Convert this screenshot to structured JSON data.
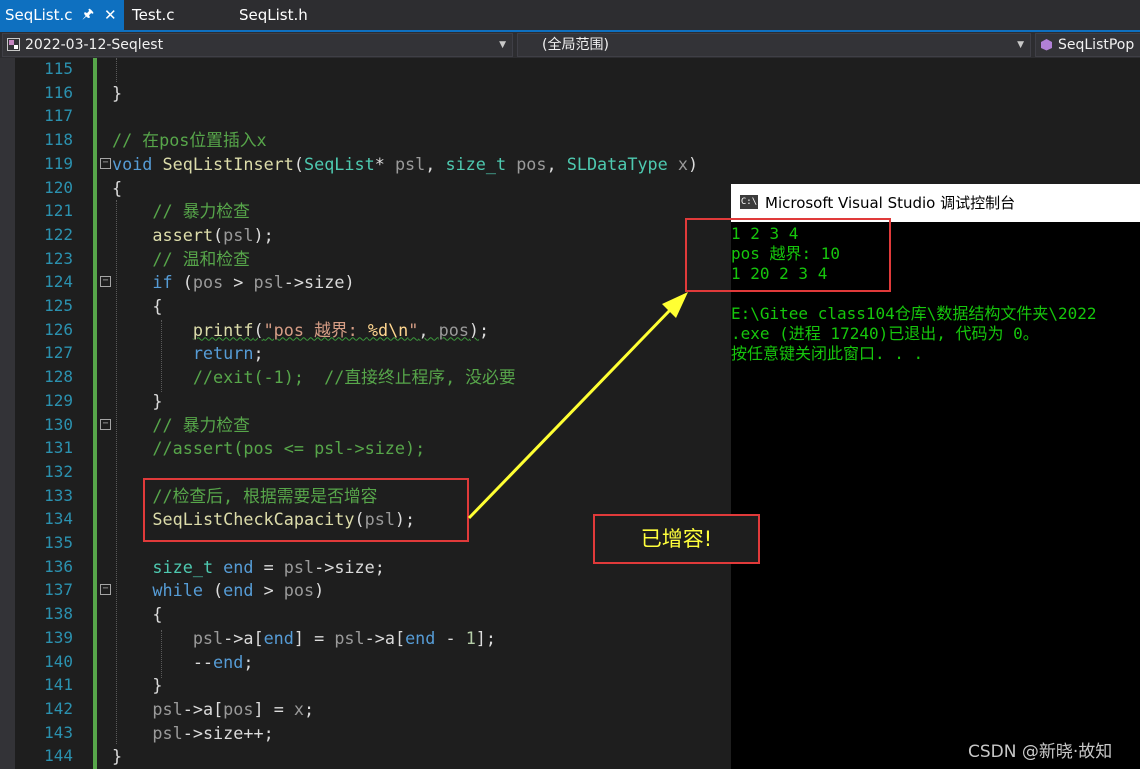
{
  "tabs": [
    {
      "label": "SeqList.c",
      "active": true
    },
    {
      "label": "Test.c",
      "active": false
    },
    {
      "label": "SeqList.h",
      "active": false
    }
  ],
  "tab_pin_icon": "pin-icon",
  "tab_close_icon": "close-icon",
  "navbar": {
    "project": "2022-03-12-Seqlest",
    "scope": "(全局范围)",
    "member": "SeqListPop"
  },
  "editor": {
    "lines": [
      {
        "n": "115",
        "html": "<span class=\"pa\"></span>"
      },
      {
        "n": "116",
        "html": "}"
      },
      {
        "n": "117",
        "html": ""
      },
      {
        "n": "118",
        "html": "<span class=\"cm\">// 在pos位置插入x</span>"
      },
      {
        "n": "119",
        "html": "<span class=\"kw\">void</span> <span class=\"fn\">SeqListInsert</span>(<span class=\"ty\">SeqList</span>* <span class=\"pa\">psl</span>, <span class=\"ty\">size_t</span> <span class=\"pa\">pos</span>, <span class=\"ty\">SLDataType</span> <span class=\"pa\">x</span>)"
      },
      {
        "n": "120",
        "html": "{"
      },
      {
        "n": "121",
        "html": "    <span class=\"cm\">// 暴力检查</span>"
      },
      {
        "n": "122",
        "html": "    <span class=\"fn\">assert</span>(<span class=\"pa\">psl</span>);"
      },
      {
        "n": "123",
        "html": "    <span class=\"cm\">// 温和检查</span>"
      },
      {
        "n": "124",
        "html": "    <span class=\"kw\">if</span> (<span class=\"pa\">pos</span> &gt; <span class=\"pa\">psl</span>-&gt;<span class=\"mb\">size</span>)"
      },
      {
        "n": "125",
        "html": "    {"
      },
      {
        "n": "126",
        "html": "        <span class=\"squiggle\"><span class=\"fn\">printf</span>(<span class=\"st\">\"pos 越界: </span><span class=\"es\">%d\\n</span><span class=\"st\">\"</span>, <span class=\"pa\">pos</span>)</span>;"
      },
      {
        "n": "127",
        "html": "        <span class=\"kw\">return</span>;"
      },
      {
        "n": "128",
        "html": "        <span class=\"cm\">//exit(-1);  //直接终止程序, 没必要</span>"
      },
      {
        "n": "129",
        "html": "    }"
      },
      {
        "n": "130",
        "html": "    <span class=\"cm\">// 暴力检查</span>"
      },
      {
        "n": "131",
        "html": "    <span class=\"cm\">//assert(pos &lt;= psl-&gt;size);</span>"
      },
      {
        "n": "132",
        "html": ""
      },
      {
        "n": "133",
        "html": "    <span class=\"cm\">//检查后, 根据需要是否增容</span>"
      },
      {
        "n": "134",
        "html": "    <span class=\"fn\">SeqListCheckCapacity</span>(<span class=\"pa\">psl</span>);"
      },
      {
        "n": "135",
        "html": ""
      },
      {
        "n": "136",
        "html": "    <span class=\"ty\">size_t</span> <span class=\"kw\">end</span> = <span class=\"pa\">psl</span>-&gt;<span class=\"mb\">size</span>;"
      },
      {
        "n": "137",
        "html": "    <span class=\"kw\">while</span> (<span class=\"kw\">end</span> &gt; <span class=\"pa\">pos</span>)"
      },
      {
        "n": "138",
        "html": "    {"
      },
      {
        "n": "139",
        "html": "        <span class=\"pa\">psl</span>-&gt;<span class=\"mb\">a</span>[<span class=\"kw\">end</span>] = <span class=\"pa\">psl</span>-&gt;<span class=\"mb\">a</span>[<span class=\"kw\">end</span> - <span class=\"num\">1</span>];"
      },
      {
        "n": "140",
        "html": "        --<span class=\"kw\">end</span>;"
      },
      {
        "n": "141",
        "html": "    }"
      },
      {
        "n": "142",
        "html": "    <span class=\"pa\">psl</span>-&gt;<span class=\"mb\">a</span>[<span class=\"pa\">pos</span>] = <span class=\"pa\">x</span>;"
      },
      {
        "n": "143",
        "html": "    <span class=\"pa\">psl</span>-&gt;<span class=\"mb\">size</span>++;"
      },
      {
        "n": "144",
        "html": "}"
      }
    ]
  },
  "console": {
    "title": "Microsoft Visual Studio 调试控制台",
    "icon": "console-icon",
    "lines": [
      "1 2 3 4",
      "pos 越界: 10",
      "1 20 2 3 4",
      "",
      "E:\\Gitee class104仓库\\数据结构文件夹\\2022",
      ".exe (进程 17240)已退出, 代码为 0。",
      "按任意键关闭此窗口. . ."
    ]
  },
  "annotation": {
    "label": "已增容!",
    "border_color": "#e03a3a",
    "arrow_color": "#ffff33"
  },
  "watermark": "CSDN @新晓·故知",
  "colors": {
    "tab_active": "#0e70c0",
    "editor_bg": "#1e1e1e",
    "console_text": "#16c60c",
    "line_number": "#2b91af"
  }
}
